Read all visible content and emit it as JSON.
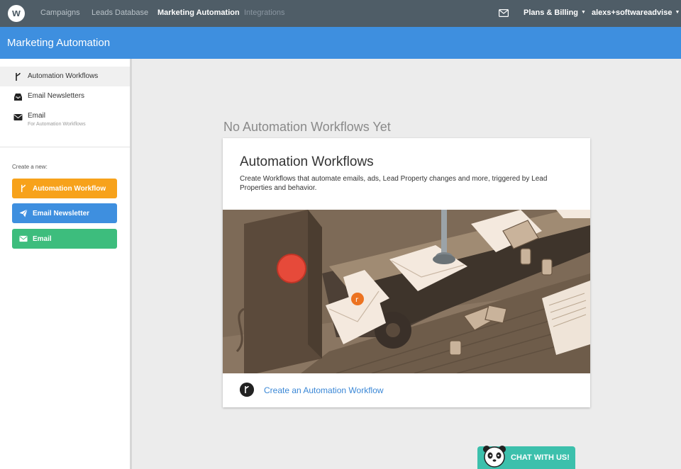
{
  "topnav": {
    "logo_letter": "w",
    "links": [
      {
        "label": "Campaigns",
        "state": "inactive"
      },
      {
        "label": "Leads Database",
        "state": "inactive"
      },
      {
        "label": "Marketing Automation",
        "state": "active"
      },
      {
        "label": "Integrations",
        "state": "disabled"
      }
    ],
    "mail_icon": "envelope-icon",
    "plans_label": "Plans & Billing",
    "account_label": "alexs+softwareadvise"
  },
  "header": {
    "title": "Marketing Automation"
  },
  "sidebar": {
    "items": [
      {
        "label": "Automation Workflows",
        "icon": "workflow-icon",
        "active": true
      },
      {
        "label": "Email Newsletters",
        "icon": "inbox-icon",
        "active": false
      },
      {
        "label": "Email",
        "sublabel": "For Automation Workflows",
        "icon": "envelope-icon",
        "active": false
      }
    ],
    "create_label": "Create a new:",
    "create_buttons": [
      {
        "label": "Automation Workflow",
        "color": "#f7a21b",
        "icon": "workflow-icon"
      },
      {
        "label": "Email Newsletter",
        "color": "#3e8fdf",
        "icon": "paper-plane-icon"
      },
      {
        "label": "Email",
        "color": "#3dbd7d",
        "icon": "envelope-icon"
      }
    ]
  },
  "main": {
    "empty_title": "No Automation Workflows Yet",
    "card": {
      "title": "Automation Workflows",
      "description": "Create Workflows that automate emails, ads, Lead Property changes and more, triggered by Lead Properties and behavior.",
      "cta_label": "Create an Automation Workflow"
    }
  },
  "chat": {
    "label": "CHAT WITH US!"
  },
  "colors": {
    "topnav_bg": "#4f5d67",
    "header_bg": "#3e8fdf",
    "link_blue": "#3a87d6",
    "chat_bg": "#3cc0ac"
  }
}
